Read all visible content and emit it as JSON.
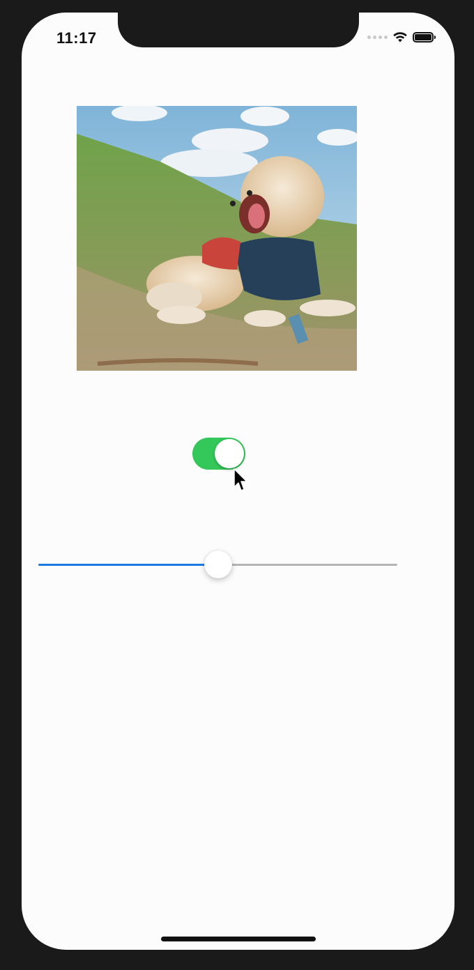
{
  "status_bar": {
    "time": "11:17"
  },
  "content": {
    "image": {
      "icon": "dog-photo"
    },
    "toggle": {
      "on": true,
      "color": "#34c759"
    },
    "slider": {
      "value": 0.5,
      "fill_color": "#1f7ae0",
      "track_color": "#b5b5b5"
    }
  }
}
